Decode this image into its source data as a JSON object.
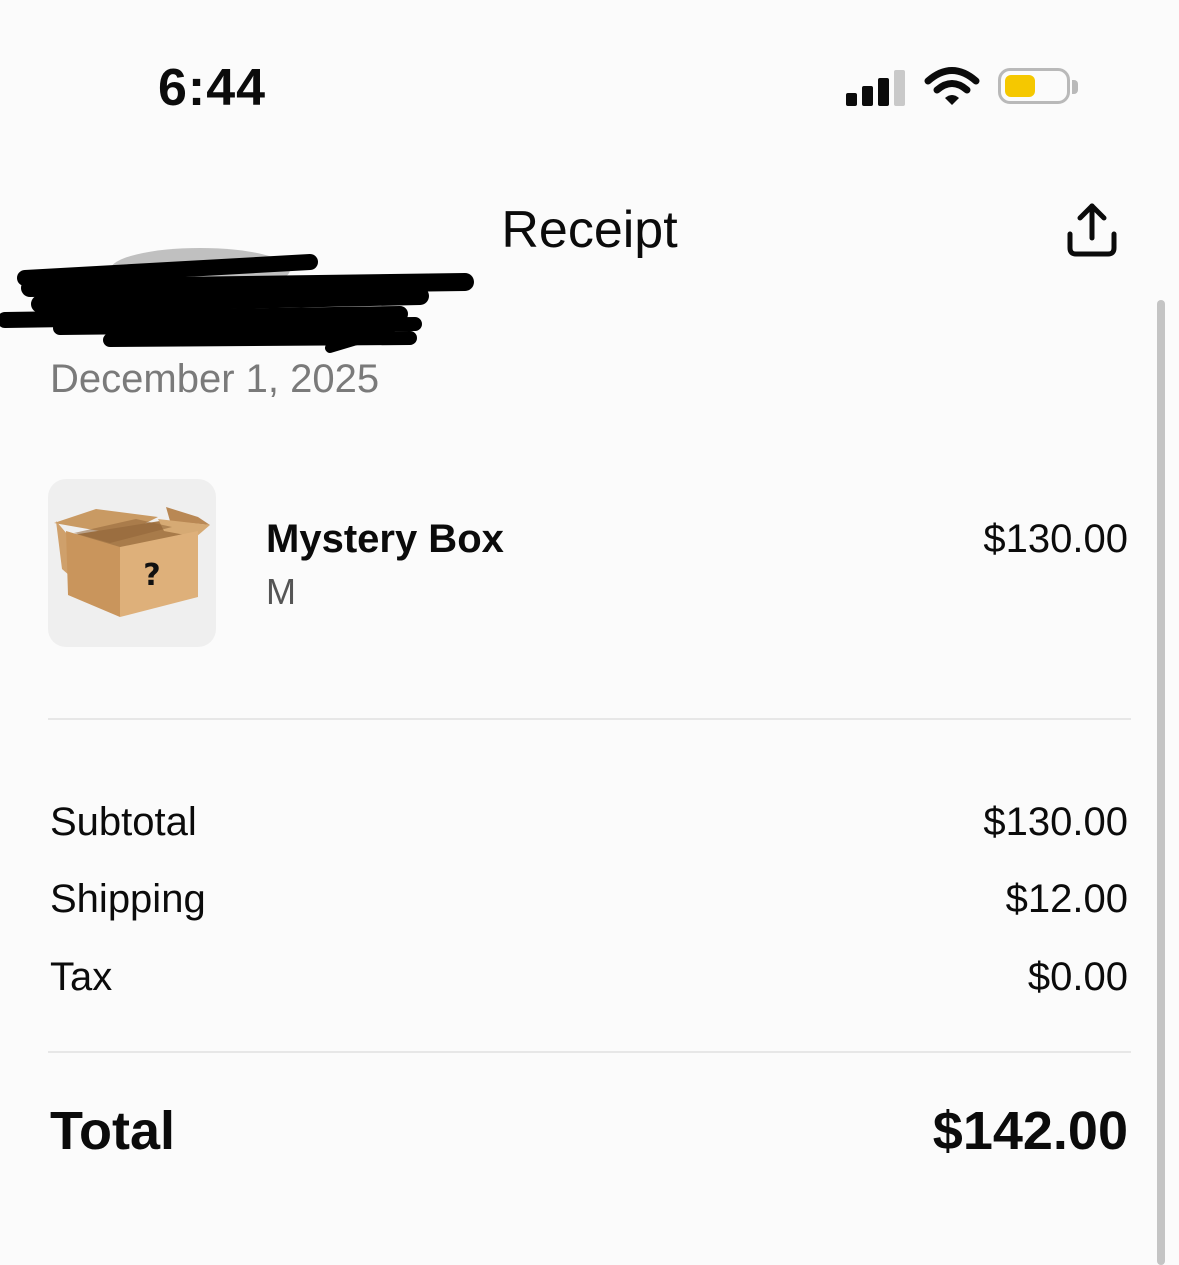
{
  "status_bar": {
    "time": "6:44",
    "battery_color": "#f5c800"
  },
  "header": {
    "title": "Receipt",
    "share_icon": "share-upload-icon"
  },
  "order": {
    "date": "December 1, 2025"
  },
  "item": {
    "name": "Mystery Box",
    "variant": "M",
    "price": "$130.00",
    "image_icon": "cardboard-box-icon",
    "image_mark": "?"
  },
  "summary": {
    "subtotal_label": "Subtotal",
    "subtotal_value": "$130.00",
    "shipping_label": "Shipping",
    "shipping_value": "$12.00",
    "tax_label": "Tax",
    "tax_value": "$0.00",
    "total_label": "Total",
    "total_value": "$142.00"
  }
}
